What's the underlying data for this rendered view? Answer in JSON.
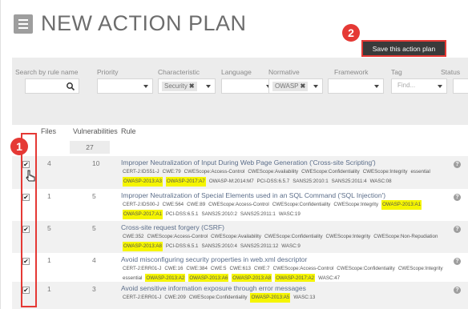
{
  "header": {
    "title": "NEW ACTION PLAN",
    "save_label": "Save this action plan"
  },
  "badges": {
    "save": "2",
    "checkboxes": "1"
  },
  "filters": {
    "search_label": "Search by rule name",
    "priority_label": "Priority",
    "characteristic_label": "Characteristic",
    "characteristic_chip": "Security",
    "language_label": "Language",
    "normative_label": "Normative",
    "normative_chip": "OWASP",
    "framework_label": "Framework",
    "tag_label": "Tag",
    "tag_placeholder": "Find...",
    "status_label": "Status"
  },
  "table": {
    "headers": {
      "files": "Files",
      "vulnerabilities": "Vulnerabilities",
      "rule": "Rule"
    },
    "total_vulnerabilities": "27",
    "rows": [
      {
        "files": "4",
        "vulns": "10",
        "checked": "✔",
        "name": "Improper Neutralization of Input During Web Page Generation ('Cross-site Scripting')",
        "tags": [
          {
            "t": "CERT-J:IDS51-J",
            "hl": false
          },
          {
            "t": "CWE:79",
            "hl": false
          },
          {
            "t": "CWEScope:Access-Control",
            "hl": false
          },
          {
            "t": "CWEScope:Availability",
            "hl": false
          },
          {
            "t": "CWEScope:Confidentiality",
            "hl": false
          },
          {
            "t": "CWEScope:Integrity",
            "hl": false
          },
          {
            "t": "essential",
            "hl": false
          },
          {
            "t": "OWASP-2013:A3",
            "hl": true
          },
          {
            "t": "OWASP-2017:A7",
            "hl": true
          },
          {
            "t": "OWASP-M:2014:M7",
            "hl": false
          },
          {
            "t": "PCI-DSS:6.5.7",
            "hl": false
          },
          {
            "t": "SANS25:2010:1",
            "hl": false
          },
          {
            "t": "SANS25:2011:4",
            "hl": false
          },
          {
            "t": "WASC:08",
            "hl": false
          }
        ]
      },
      {
        "files": "1",
        "vulns": "5",
        "checked": "✔",
        "name": "Improper Neutralization of Special Elements used in an SQL Command ('SQL Injection')",
        "tags": [
          {
            "t": "CERT-J:IDS00-J",
            "hl": false
          },
          {
            "t": "CWE:564",
            "hl": false
          },
          {
            "t": "CWE:89",
            "hl": false
          },
          {
            "t": "CWEScope:Access-Control",
            "hl": false
          },
          {
            "t": "CWEScope:Confidentiality",
            "hl": false
          },
          {
            "t": "CWEScope:Integrity",
            "hl": false
          },
          {
            "t": "OWASP-2013:A1",
            "hl": true
          },
          {
            "t": "OWASP-2017:A1",
            "hl": true
          },
          {
            "t": "PCI-DSS:6.5.1",
            "hl": false
          },
          {
            "t": "SANS25:2010:2",
            "hl": false
          },
          {
            "t": "SANS25:2011:1",
            "hl": false
          },
          {
            "t": "WASC:19",
            "hl": false
          }
        ]
      },
      {
        "files": "5",
        "vulns": "5",
        "checked": "✔",
        "name": "Cross-site request forgery (CSRF)",
        "tags": [
          {
            "t": "CWE:352",
            "hl": false
          },
          {
            "t": "CWEScope:Access-Control",
            "hl": false
          },
          {
            "t": "CWEScope:Availability",
            "hl": false
          },
          {
            "t": "CWEScope:Confidentiality",
            "hl": false
          },
          {
            "t": "CWEScope:Integrity",
            "hl": false
          },
          {
            "t": "CWEScope:Non-Repudiation",
            "hl": false
          },
          {
            "t": "OWASP-2013:A8",
            "hl": true
          },
          {
            "t": "PCI-DSS:6.5.1",
            "hl": false
          },
          {
            "t": "SANS25:2010:4",
            "hl": false
          },
          {
            "t": "SANS25:2011:12",
            "hl": false
          },
          {
            "t": "WASC:9",
            "hl": false
          }
        ]
      },
      {
        "files": "1",
        "vulns": "4",
        "checked": "✔",
        "name": "Avoid misconfiguring security properties in web.xml descriptor",
        "tags": [
          {
            "t": "CERT-J:ERR01-J",
            "hl": false
          },
          {
            "t": "CWE:16",
            "hl": false
          },
          {
            "t": "CWE:384",
            "hl": false
          },
          {
            "t": "CWE:5",
            "hl": false
          },
          {
            "t": "CWE:613",
            "hl": false
          },
          {
            "t": "CWE:7",
            "hl": false
          },
          {
            "t": "CWEScope:Access-Control",
            "hl": false
          },
          {
            "t": "CWEScope:Confidentiality",
            "hl": false
          },
          {
            "t": "CWEScope:Integrity",
            "hl": false
          },
          {
            "t": "essential",
            "hl": false
          },
          {
            "t": "OWASP-2013:A2",
            "hl": true
          },
          {
            "t": "OWASP-2013:A6",
            "hl": true
          },
          {
            "t": "OWASP-2013:A8",
            "hl": true
          },
          {
            "t": "OWASP-2017:A2",
            "hl": true
          },
          {
            "t": "WASC:47",
            "hl": false
          }
        ]
      },
      {
        "files": "1",
        "vulns": "3",
        "checked": "✔",
        "name": "Avoid sensitive information exposure through error messages",
        "tags": [
          {
            "t": "CERT-J:ERR01-J",
            "hl": false
          },
          {
            "t": "CWE:209",
            "hl": false
          },
          {
            "t": "CWEScope:Confidentiality",
            "hl": false
          },
          {
            "t": "OWASP-2013:A5",
            "hl": true
          },
          {
            "t": "WASC:13",
            "hl": false
          }
        ]
      }
    ]
  },
  "icons": {
    "menu": "menu-icon",
    "search": "search-icon",
    "help": "help-icon",
    "cursor": "hand-cursor-icon",
    "chip_remove": "close-icon"
  },
  "colors": {
    "highlight": "#f5f500",
    "annotation_red": "#e53935",
    "save_button_bg": "#3a3a3a",
    "rule_link": "#5c6e8a"
  }
}
